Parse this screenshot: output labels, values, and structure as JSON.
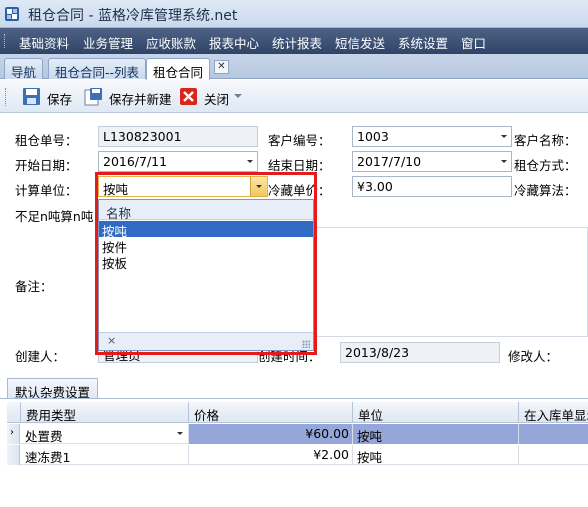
{
  "window": {
    "title": "租仓合同 - 蓝格冷库管理系统.net"
  },
  "menu": [
    "基础资料",
    "业务管理",
    "应收账款",
    "报表中心",
    "统计报表",
    "短信发送",
    "系统设置",
    "窗口"
  ],
  "tabs": [
    "导航",
    "租仓合同--列表",
    "租仓合同"
  ],
  "tab_close": "✕",
  "toolbar": {
    "save": "保存",
    "save_new": "保存并新建",
    "close": "关闭"
  },
  "form": {
    "contract_no_label": "租仓单号：",
    "contract_no": "L130823001",
    "customer_no_label": "客户编号：",
    "customer_no": "1003",
    "customer_name_label": "客户名称：",
    "start_date_label": "开始日期：",
    "start_date": "2016/7/11",
    "end_date_label": "结束日期：",
    "end_date": "2017/7/10",
    "rent_mode_label": "租仓方式：",
    "calc_unit_label": "计算单位：",
    "calc_unit": "按吨",
    "cold_price_label": "冷藏单价：",
    "cold_price": "¥3.00",
    "cold_algo_label": "冷藏算法：",
    "min_ton_label": "不足n吨算n吨：",
    "remark_label": "备注：",
    "creator_label": "创建人：",
    "creator": "管理员",
    "create_time_label": "创建时间：",
    "create_time": "2013/8/23",
    "modifier_label": "修改人："
  },
  "dropdown": {
    "header": "名称",
    "options": [
      "按吨",
      "按件",
      "按板"
    ],
    "selected": 0,
    "footer_close": "×"
  },
  "subtab": "默认杂费设置",
  "grid": {
    "columns": [
      "费用类型",
      "价格",
      "单位",
      "在入库单显示"
    ],
    "rows": [
      {
        "type": "处置费",
        "price": "¥60.00",
        "unit": "按吨"
      },
      {
        "type": "速冻费1",
        "price": "¥2.00",
        "unit": "按吨"
      }
    ]
  },
  "colors": {
    "menubar": "#3a4f72",
    "highlight_red": "#e31b1b",
    "selection_blue": "#316ac5",
    "grid_selection": "#95a6d9"
  }
}
